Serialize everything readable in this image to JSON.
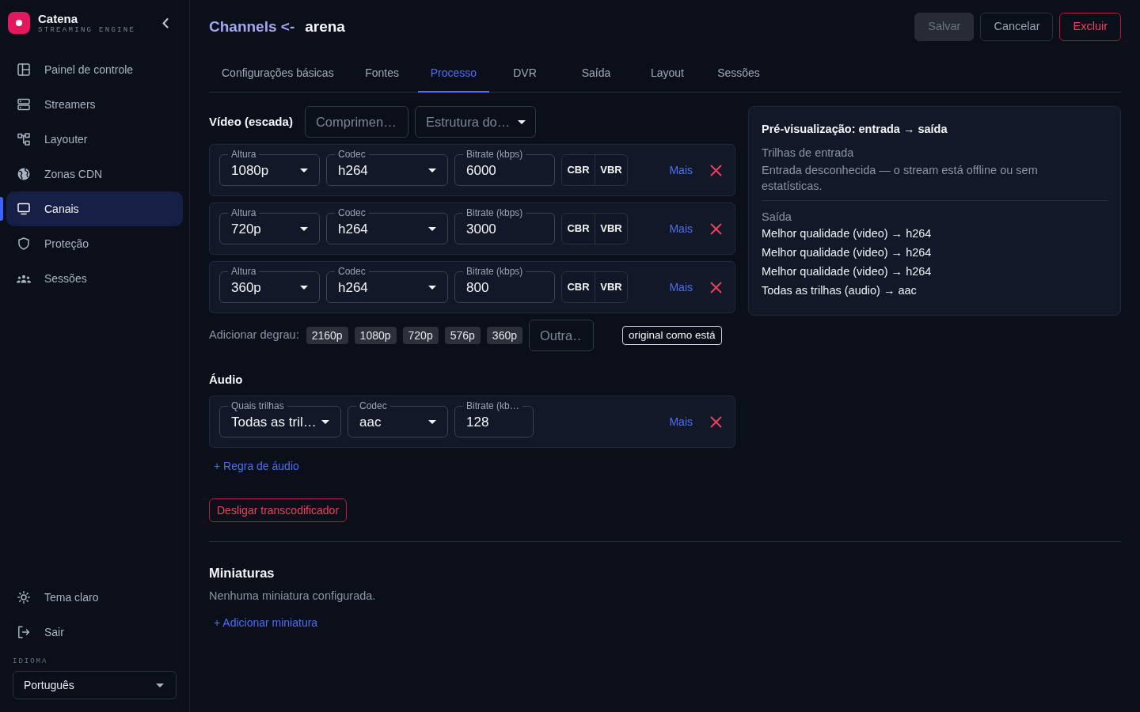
{
  "sidebar": {
    "brand": {
      "name": "Catena",
      "tagline": "STREAMING ENGINE"
    },
    "nav": [
      {
        "label": "Painel de controle",
        "selected": false
      },
      {
        "label": "Streamers",
        "selected": false
      },
      {
        "label": "Layouter",
        "selected": false
      },
      {
        "label": "Zonas CDN",
        "selected": false
      },
      {
        "label": "Canais",
        "selected": true
      },
      {
        "label": "Proteção",
        "selected": false
      },
      {
        "label": "Sessões",
        "selected": false
      }
    ],
    "footer": [
      "Tema claro",
      "Sair"
    ],
    "language": {
      "label": "IDIOMA",
      "value": "Português"
    }
  },
  "header": {
    "breadcrumb": "Channels <-",
    "title": "arena",
    "buttons": [
      {
        "label": "Salvar",
        "kind": "primary",
        "disabled": true
      },
      {
        "label": "Cancelar",
        "kind": "secondary",
        "disabled": false
      },
      {
        "label": "Excluir",
        "kind": "danger",
        "disabled": false
      }
    ]
  },
  "tabs": [
    {
      "label": "Configurações básicas",
      "selected": false
    },
    {
      "label": "Fontes",
      "selected": false
    },
    {
      "label": "Processo",
      "selected": true
    },
    {
      "label": "DVR",
      "selected": false
    },
    {
      "label": "Saída",
      "selected": false
    },
    {
      "label": "Layout",
      "selected": false
    },
    {
      "label": "Sessões",
      "selected": false
    }
  ],
  "video": {
    "title": "Vídeo (escada)",
    "length_field": {
      "placeholder": "Comprimen…"
    },
    "structure_select": {
      "placeholder": "Estrutura do…"
    },
    "rungs": [
      {
        "fields": [
          {
            "kind": "select",
            "label": "Altura",
            "value": "1080p"
          },
          {
            "kind": "select",
            "label": "Codec",
            "value": "h264"
          },
          {
            "kind": "input",
            "label": "Bitrate (kbps)",
            "value": "6000"
          }
        ],
        "modes": [
          "CBR",
          "VBR"
        ],
        "more": "Mais"
      },
      {
        "fields": [
          {
            "kind": "select",
            "label": "Altura",
            "value": "720p"
          },
          {
            "kind": "select",
            "label": "Codec",
            "value": "h264"
          },
          {
            "kind": "input",
            "label": "Bitrate (kbps)",
            "value": "3000"
          }
        ],
        "modes": [
          "CBR",
          "VBR"
        ],
        "more": "Mais"
      },
      {
        "fields": [
          {
            "kind": "select",
            "label": "Altura",
            "value": "360p"
          },
          {
            "kind": "select",
            "label": "Codec",
            "value": "h264"
          },
          {
            "kind": "input",
            "label": "Bitrate (kbps)",
            "value": "800"
          }
        ],
        "modes": [
          "CBR",
          "VBR"
        ],
        "more": "Mais"
      }
    ],
    "add_rung": {
      "label": "Adicionar degrau:",
      "presets": [
        "2160p",
        "1080p",
        "720p",
        "576p",
        "360p"
      ],
      "custom": {
        "placeholder": "Outra…"
      },
      "original_button": "original como está"
    }
  },
  "audio": {
    "title": "Áudio",
    "rules": [
      {
        "fields": [
          {
            "kind": "select",
            "label": "Quais trilhas",
            "value": "Todas as tril…"
          },
          {
            "kind": "select",
            "label": "Codec",
            "value": "aac"
          },
          {
            "kind": "input",
            "label": "Bitrate (kb…",
            "value": "128"
          }
        ],
        "more": "Mais"
      }
    ],
    "add_rule": "+ Regra de áudio"
  },
  "disable_button": "Desligar transcodificador",
  "thumbnails": {
    "title": "Miniaturas",
    "empty_text": "Nenhuma miniatura configurada.",
    "add_link": "+ Adicionar miniatura"
  },
  "preview": {
    "title": "Pré-visualização: entrada → saída",
    "input_heading": "Trilhas de entrada",
    "input_text": "Entrada desconhecida — o stream está offline ou sem estatísticas.",
    "output_heading": "Saída",
    "output_lines": [
      "Melhor qualidade (video) → h264",
      "Melhor qualidade (video) → h264",
      "Melhor qualidade (video) → h264",
      "Todas as trilhas (audio) → aac"
    ]
  }
}
